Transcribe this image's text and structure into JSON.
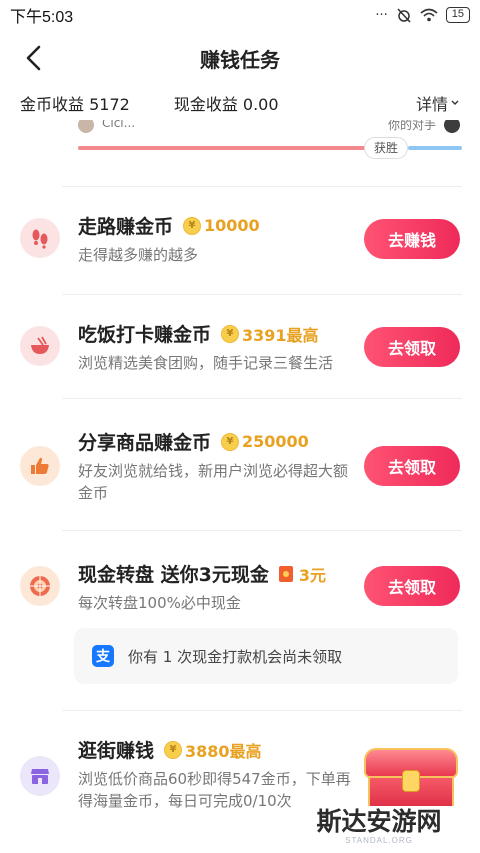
{
  "status_bar": {
    "time": "下午5:03",
    "battery": "15"
  },
  "nav": {
    "title": "赚钱任务"
  },
  "earnings": {
    "coin_label": "金币收益 5172",
    "cash_label": "现金收益 0.00",
    "details_label": "详情"
  },
  "vs_bar": {
    "left_name": "Cici...",
    "right_name": "你的对手",
    "badge": "获胜"
  },
  "tasks": [
    {
      "title": "走路赚金币",
      "reward": "10000",
      "desc": "走得越多赚的越多",
      "button": "去赚钱",
      "icon": "footprints-icon"
    },
    {
      "title": "吃饭打卡赚金币",
      "reward": "3391最高",
      "desc": "浏览精选美食团购，随手记录三餐生活",
      "button": "去领取",
      "icon": "bowl-icon"
    },
    {
      "title": "分享商品赚金币",
      "reward": "250000",
      "desc": "好友浏览就给钱，新用户浏览必得超大额金币",
      "button": "去领取",
      "icon": "thumbs-up-icon"
    },
    {
      "title": "现金转盘 送你3元现金",
      "reward": "3元",
      "desc": "每次转盘100%必中现金",
      "button": "去领取",
      "icon": "wheel-icon"
    },
    {
      "title": "逛街赚钱",
      "reward": "3880最高",
      "desc": "浏览低价商品60秒即得547金币，下单再得海量金币，每日可完成0/10次",
      "icon": "shop-icon"
    }
  ],
  "cash_tip": {
    "text": "你有 1 次现金打款机会尚未领取",
    "icon": "alipay-icon"
  },
  "watermark": {
    "text": "斯达安游网",
    "sub": "STANDAL.ORG"
  },
  "colors": {
    "button_gradient_start": "#ff5373",
    "button_gradient_end": "#ef2a5a",
    "reward": "#e8a120"
  }
}
